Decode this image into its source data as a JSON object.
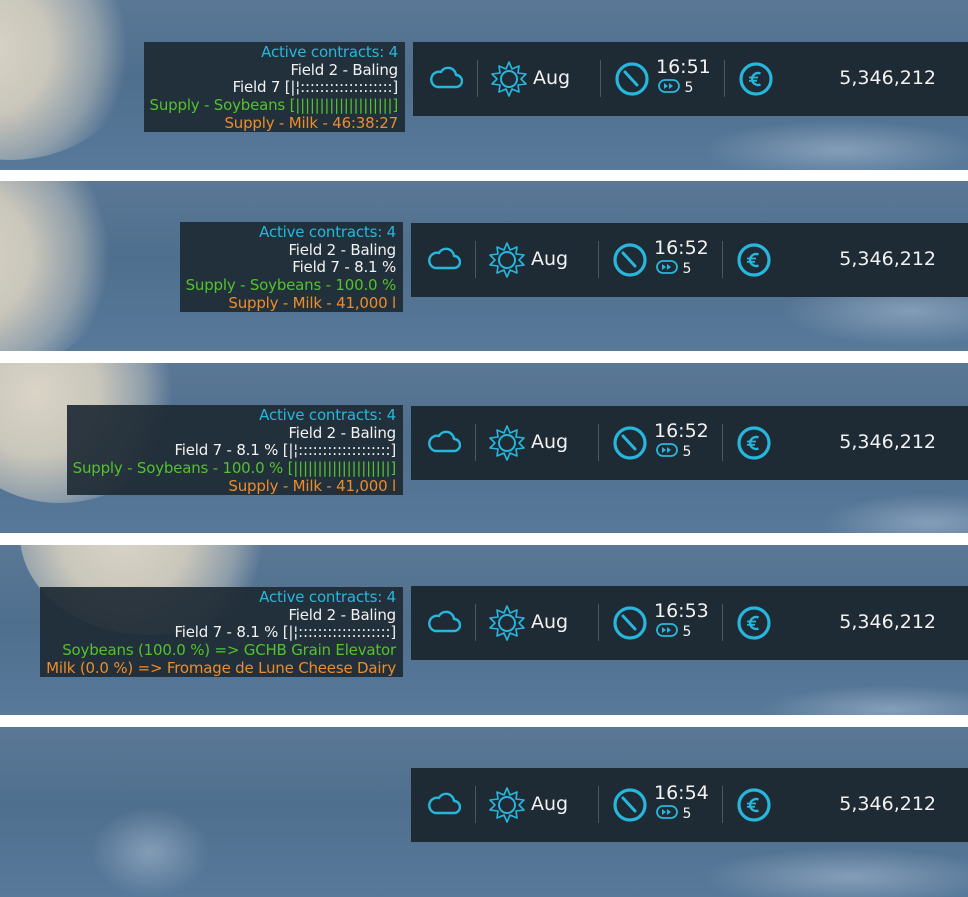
{
  "colors": {
    "accent": "#27b7dc",
    "white_text": "#f2f2f2",
    "green_text": "#53c22c",
    "orange_text": "#ee8c2b",
    "panel": "#1e2a34"
  },
  "icons": [
    "cloud-icon",
    "sun-icon",
    "clock-icon",
    "fast-forward-icon",
    "euro-icon"
  ],
  "frames": [
    {
      "contracts": {
        "title": "Active contracts: 4",
        "lines": [
          "Field 2 - Baling",
          "Field 7 [|¦:::::::::::::::::::]",
          "Supply - Soybeans [||||||||||||||||||||]",
          "Supply - Milk - 46:38:27"
        ]
      },
      "hud": {
        "month": "Aug",
        "time": "16:51",
        "speed": "5",
        "money": "5,346,212"
      }
    },
    {
      "contracts": {
        "title": "Active contracts: 4",
        "lines": [
          "Field 2 - Baling",
          "Field 7 - 8.1 %",
          "Supply - Soybeans - 100.0 %",
          "Supply - Milk - 41,000  l"
        ]
      },
      "hud": {
        "month": "Aug",
        "time": "16:52",
        "speed": "5",
        "money": "5,346,212"
      }
    },
    {
      "contracts": {
        "title": "Active contracts: 4",
        "lines": [
          "Field 2 - Baling",
          "Field 7 - 8.1 % [|¦:::::::::::::::::::]",
          "Supply - Soybeans - 100.0 % [||||||||||||||||||||]",
          "Supply - Milk - 41,000  l"
        ]
      },
      "hud": {
        "month": "Aug",
        "time": "16:52",
        "speed": "5",
        "money": "5,346,212"
      }
    },
    {
      "contracts": {
        "title": "Active contracts: 4",
        "lines": [
          "Field 2 - Baling",
          "Field 7 - 8.1 % [|¦:::::::::::::::::::]",
          "Soybeans (100.0 %) => GCHB Grain Elevator",
          "Milk (0.0 %) => Fromage de Lune Cheese Dairy"
        ]
      },
      "hud": {
        "month": "Aug",
        "time": "16:53",
        "speed": "5",
        "money": "5,346,212"
      }
    },
    {
      "hud": {
        "month": "Aug",
        "time": "16:54",
        "speed": "5",
        "money": "5,346,212"
      }
    }
  ]
}
